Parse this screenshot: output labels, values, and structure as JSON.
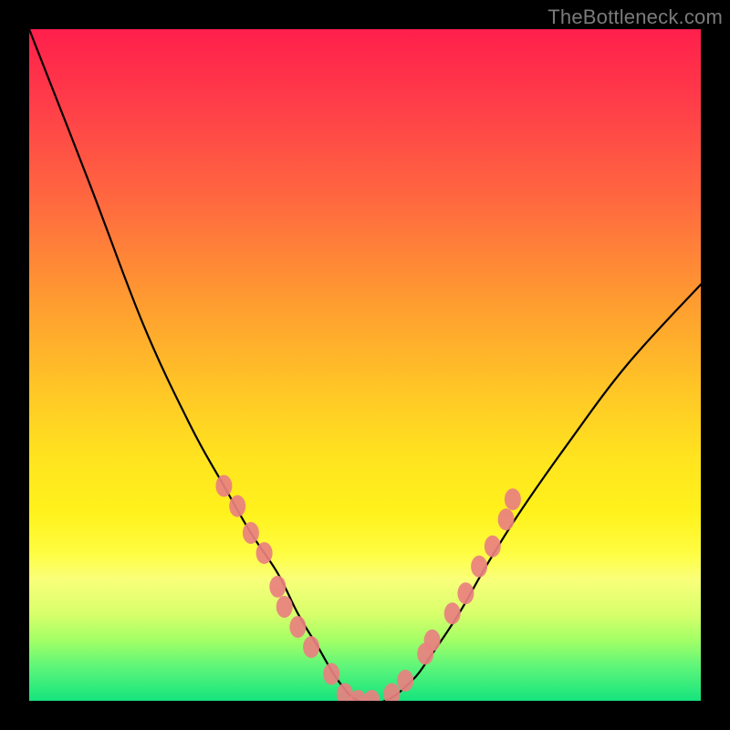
{
  "watermark": "TheBottleneck.com",
  "chart_data": {
    "type": "line",
    "title": "",
    "xlabel": "",
    "ylabel": "",
    "xlim": [
      0,
      1
    ],
    "ylim": [
      0,
      1
    ],
    "grid": false,
    "legend": false,
    "annotations": [],
    "series": [
      {
        "name": "curve",
        "color": "#000000",
        "x": [
          0.0,
          0.09,
          0.17,
          0.24,
          0.29,
          0.33,
          0.37,
          0.4,
          0.43,
          0.46,
          0.49,
          0.53,
          0.57,
          0.6,
          0.64,
          0.68,
          0.73,
          0.8,
          0.89,
          1.0
        ],
        "y": [
          1.0,
          0.77,
          0.56,
          0.41,
          0.32,
          0.25,
          0.19,
          0.13,
          0.08,
          0.03,
          0.0,
          0.0,
          0.03,
          0.07,
          0.13,
          0.2,
          0.28,
          0.38,
          0.5,
          0.62
        ]
      },
      {
        "name": "markers",
        "color": "#e98080",
        "type": "scatter",
        "points": [
          {
            "x": 0.29,
            "y": 0.32
          },
          {
            "x": 0.31,
            "y": 0.29
          },
          {
            "x": 0.33,
            "y": 0.25
          },
          {
            "x": 0.35,
            "y": 0.22
          },
          {
            "x": 0.37,
            "y": 0.17
          },
          {
            "x": 0.38,
            "y": 0.14
          },
          {
            "x": 0.4,
            "y": 0.11
          },
          {
            "x": 0.42,
            "y": 0.08
          },
          {
            "x": 0.45,
            "y": 0.04
          },
          {
            "x": 0.47,
            "y": 0.01
          },
          {
            "x": 0.49,
            "y": 0.0
          },
          {
            "x": 0.51,
            "y": 0.0
          },
          {
            "x": 0.54,
            "y": 0.01
          },
          {
            "x": 0.56,
            "y": 0.03
          },
          {
            "x": 0.59,
            "y": 0.07
          },
          {
            "x": 0.6,
            "y": 0.09
          },
          {
            "x": 0.63,
            "y": 0.13
          },
          {
            "x": 0.65,
            "y": 0.16
          },
          {
            "x": 0.67,
            "y": 0.2
          },
          {
            "x": 0.69,
            "y": 0.23
          },
          {
            "x": 0.71,
            "y": 0.27
          },
          {
            "x": 0.72,
            "y": 0.3
          }
        ]
      }
    ]
  }
}
